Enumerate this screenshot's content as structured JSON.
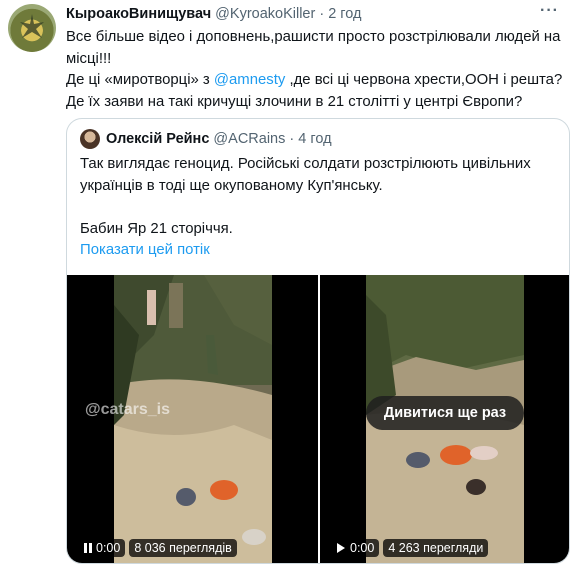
{
  "tweet": {
    "author_name": "КыроакоВинищувач",
    "author_handle": "@KyroakoKiller",
    "separator": "·",
    "time": "2 год",
    "line1": "Все більше відео і доповнень,рашисти просто розстрілювали людей на місці!!!",
    "line2_before": "Де ці «миротворці» з ",
    "line2_mention": "@amnesty",
    "line2_after": " ,де всі ці червона хрести,ООН і решта?",
    "line3": "Де їх заяви на такі кричущі злочини в 21 столітті у центрі Європи?"
  },
  "quote": {
    "author_name": "Олексій Рейнс",
    "author_handle": "@ACRains",
    "separator": "·",
    "time": "4 год",
    "paragraph1": "Так виглядає геноцид. Російські солдати розстрілюють цивільних українців в тоді ще окупованому Куп'янську.",
    "paragraph2": "Бабин Яр 21 сторіччя.",
    "thread_link": "Показати цей потік"
  },
  "videos": [
    {
      "time": "0:00",
      "views": "8 036 переглядів",
      "state": "playing",
      "watermark": "@catars_is"
    },
    {
      "time": "0:00",
      "views": "4 263 перегляди",
      "state": "ended",
      "replay_label": "Дивитися ще раз"
    }
  ],
  "colors": {
    "accent": "#1d9bf0",
    "secondary_text": "#536471",
    "border": "#cfd9de"
  },
  "icons": {
    "more": "more-icon",
    "pause": "pause-icon",
    "play": "play-icon"
  }
}
